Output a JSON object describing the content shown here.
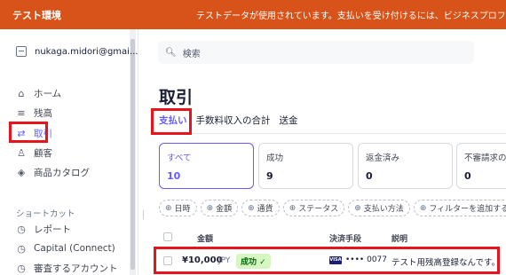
{
  "banner": {
    "env_label": "テスト環境",
    "message": "テストデータが使用されています。支払いを受け付けるには、ビジネスプロフィールを"
  },
  "sidebar": {
    "account": "nukaga.midori@gmai...",
    "items": [
      {
        "label": "ホーム",
        "icon": "home-icon"
      },
      {
        "label": "残高",
        "icon": "balance-icon"
      },
      {
        "label": "取引",
        "icon": "transactions-icon",
        "active": true
      },
      {
        "label": "顧客",
        "icon": "person-icon"
      },
      {
        "label": "商品カタログ",
        "icon": "box-icon"
      }
    ],
    "shortcuts_label": "ショートカット",
    "shortcuts": [
      {
        "label": "レポート",
        "icon": "clock-icon"
      },
      {
        "label": "Capital (Connect)",
        "icon": "clock-icon"
      },
      {
        "label": "審査するアカウント",
        "icon": "clock-icon"
      }
    ]
  },
  "search": {
    "placeholder": "検索"
  },
  "page": {
    "title": "取引",
    "tabs": [
      "支払い",
      "手数料収入の合計",
      "送金"
    ]
  },
  "cards": [
    {
      "label": "すべて",
      "value": "10",
      "active": true
    },
    {
      "label": "成功",
      "value": "9"
    },
    {
      "label": "返金済み",
      "value": "0"
    },
    {
      "label": "不審請求の",
      "value": "0"
    }
  ],
  "filters": [
    "日時",
    "金額",
    "通貨",
    "ステータス",
    "支払い方法",
    "フィルターを追加する"
  ],
  "table": {
    "headers": {
      "amount": "金額",
      "method": "決済手段",
      "description": "説明"
    },
    "rows": [
      {
        "amount": "¥10,000",
        "currency": "JPY",
        "status": "成功 ✓",
        "card_brand": "VISA",
        "last4": "•••• 0077",
        "description": "テスト用残高登録なんです。"
      }
    ]
  },
  "colors": {
    "banner": "#d8531a",
    "accent": "#635bff",
    "highlight": "#e8141b",
    "success_bg": "#d7f7c2"
  }
}
